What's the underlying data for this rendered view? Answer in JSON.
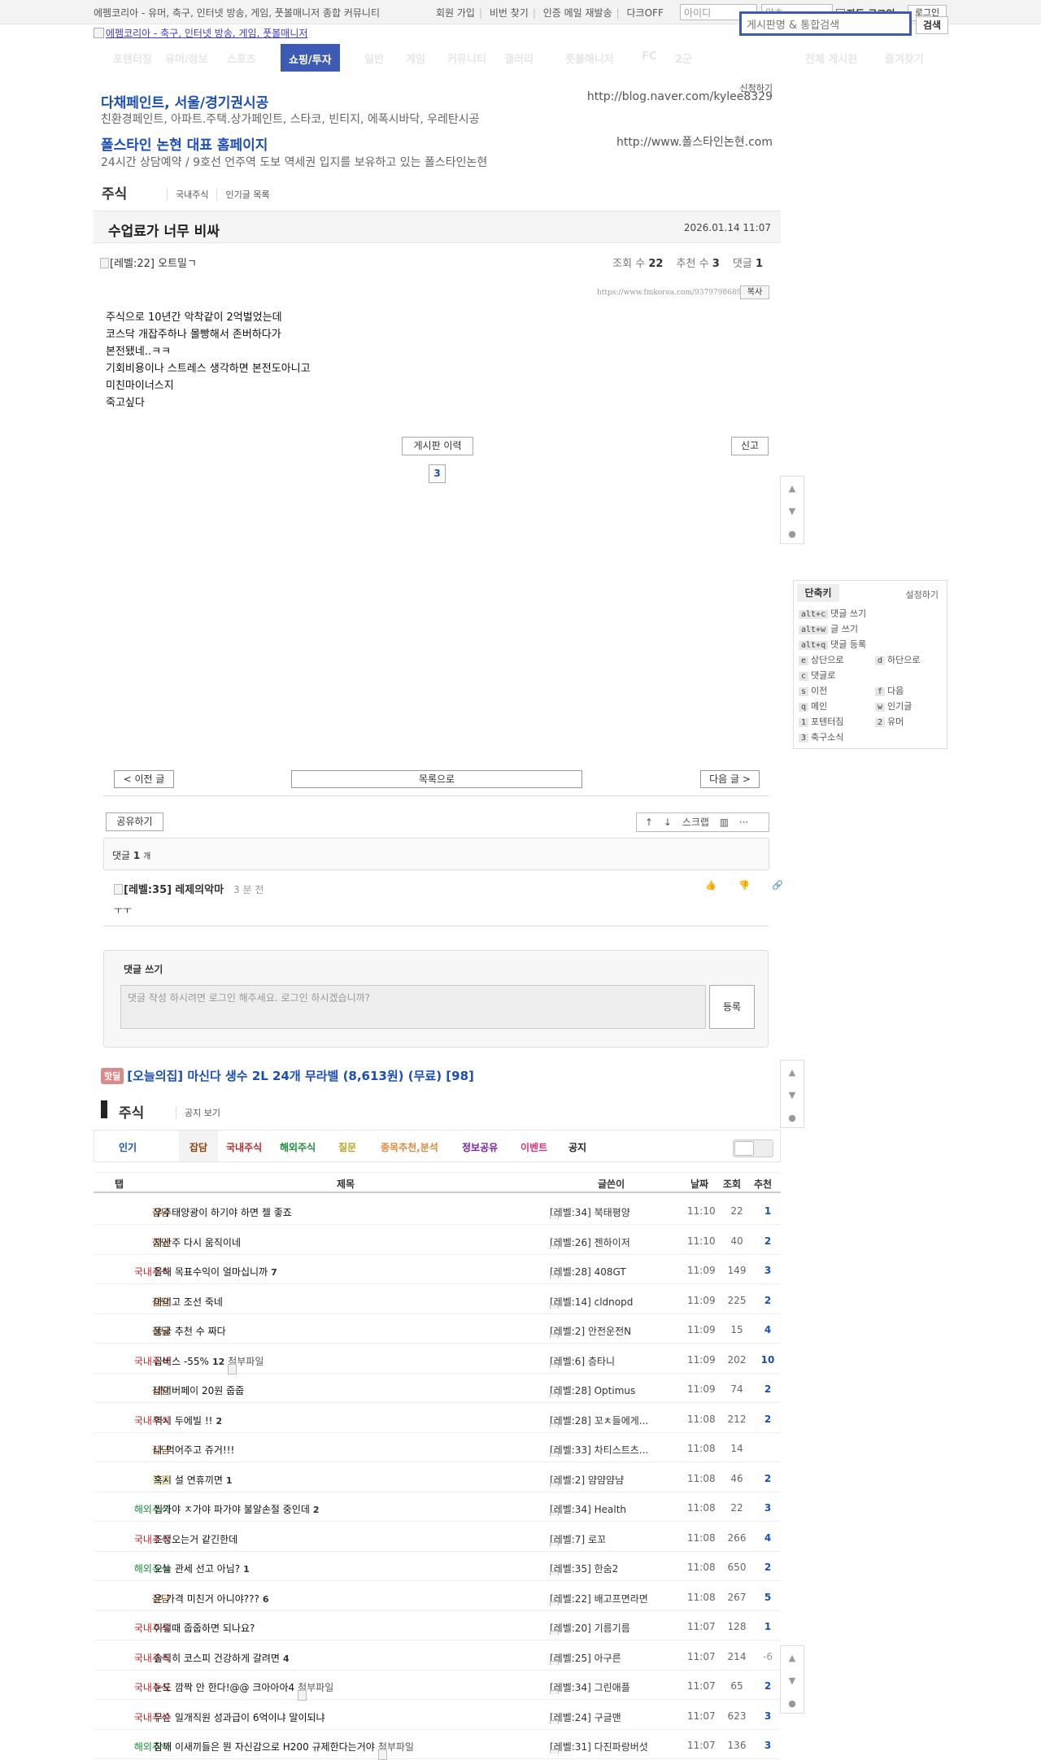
{
  "top": {
    "tagline": "에펨코리아 - 유머, 축구, 인터넷 방송, 게임, 풋볼매니저 종합 커뮤니티",
    "links": [
      "회원 가입",
      "비번 찾기",
      "인증 메일 재발송",
      "다크OFF"
    ],
    "id_placeholder": "아이디",
    "pw_placeholder": "암호",
    "auto_login": "자동 로그인",
    "login": "로그인",
    "search_placeholder": "게시판명 & 통합검색",
    "search_btn": "검색",
    "logo_text": "에펨코리아 - 축구, 인터넷 방송, 게임, 풋볼매니저"
  },
  "gnb": {
    "items": [
      "포텐터짐",
      "유머/정보",
      "스포츠",
      "쇼핑/투자",
      "일반",
      "게임",
      "커뮤니티",
      "갤러리",
      "풋볼매니저",
      "FC",
      "2군",
      "전체 게시판",
      "즐겨찾기"
    ],
    "active_index": 3
  },
  "ads": {
    "apply": "신청하기",
    "items": [
      {
        "title": "다채페인트, 서울/경기권시공",
        "desc": "친환경페인트, 아파트.주택.상가페인트, 스타코, 빈티지, 에폭시바닥, 우레탄시공",
        "url": "http://blog.naver.com/kylee8329"
      },
      {
        "title": "폴스타인 논현 대표 홈페이지",
        "desc": "24시간 상담예약 / 9호선 언주역 도보 역세권 입지를 보유하고 있는 폴스타인논현",
        "url": "http://www.폴스타인논현.com"
      }
    ]
  },
  "board": {
    "name": "주식",
    "sub_links": [
      "국내주식",
      "인기글 목록"
    ]
  },
  "post": {
    "title": "수업료가 너무 비싸",
    "date": "2026.01.14 11:07",
    "author_level": "[레벨:22]",
    "author": "오트밀ㄱ",
    "views_label": "조회 수",
    "views": "22",
    "recs_label": "추천 수",
    "recs": "3",
    "comments_label": "댓글",
    "comments": "1",
    "url": "https://www.fmkorea.com/9379798689",
    "copy": "복사",
    "lines": [
      "주식으로 10년간 악착같이 2억벌었는데",
      "코스닥 개잡주하나 몰빵해서 존버하다가",
      "본전됐네..ㅋㅋ",
      "기회비용이나 스트레스 생각하면 본전도아니고",
      "미친마이너스지",
      "죽고싶다"
    ],
    "history_btn": "게시판 이력",
    "report_btn": "신고",
    "vote_count": "3"
  },
  "floatnav": {
    "up": "▲",
    "down": "▼",
    "comment": "●"
  },
  "shortcut": {
    "title": "단축키",
    "settings": "설정하기",
    "rows": [
      {
        "key": "alt+c",
        "label": "댓글 쓰기"
      },
      {
        "key": "alt+w",
        "label": "글 쓰기"
      },
      {
        "key": "alt+q",
        "label": "댓글 등록"
      }
    ],
    "grid": [
      {
        "key": "e",
        "label": "상단으로"
      },
      {
        "key": "d",
        "label": "하단으로"
      },
      {
        "key": "c",
        "label": "댓글로"
      },
      {
        "key": "",
        "label": ""
      },
      {
        "key": "s",
        "label": "이전"
      },
      {
        "key": "f",
        "label": "다음"
      },
      {
        "key": "q",
        "label": "메인"
      },
      {
        "key": "w",
        "label": "인기글"
      },
      {
        "key": "1",
        "label": "포텐터짐"
      },
      {
        "key": "2",
        "label": "유머"
      },
      {
        "key": "3",
        "label": "축구소식"
      },
      {
        "key": "",
        "label": ""
      }
    ]
  },
  "nav": {
    "prev": "< 이전 글",
    "list": "목록으로",
    "next": "다음 글 >"
  },
  "tools": {
    "share": "공유하기",
    "items": [
      "↑",
      "↓",
      "스크랩",
      "▥",
      "···"
    ]
  },
  "comments": {
    "count_label": "댓글",
    "count": "1",
    "count_unit": "개",
    "item": {
      "level": "[레벨:35]",
      "author": "레제의악마",
      "time": "3 분 전",
      "text": "ㅜㅜ"
    },
    "icons": "👍 👎 🔗",
    "write_title": "댓글 쓰기",
    "write_placeholder": "댓글 작성 하시려면 로그인 해주세요. 로그인 하시겠습니까?",
    "submit": "등록"
  },
  "hotdeal": {
    "tag": "핫딜",
    "text": "[오늘의집] 마신다 생수 2L 24개 무라벨 (8,613원) (무료) [98]"
  },
  "list": {
    "name": "주식",
    "notice": "공지 보기",
    "cats": [
      {
        "label": "인기",
        "color": "#1b4fb5"
      },
      {
        "label": "잡담",
        "color": "#8b4513"
      },
      {
        "label": "국내주식",
        "color": "#c0282b"
      },
      {
        "label": "해외주식",
        "color": "#1a8f3a"
      },
      {
        "label": "질문",
        "color": "#b9a327"
      },
      {
        "label": "종목추천,분석",
        "color": "#e08a3c"
      },
      {
        "label": "정보공유",
        "color": "#7a1fa8"
      },
      {
        "label": "이벤트",
        "color": "#e0307a"
      },
      {
        "label": "공지",
        "color": "#222222"
      }
    ],
    "headers": [
      "탭",
      "제목",
      "글쓴이",
      "날짜",
      "조회",
      "추천"
    ],
    "rows": [
      {
        "tab": "잡담",
        "title": "우주태양광이 하기야 하면 젤 좋죠",
        "cmt": "",
        "att": "",
        "level": "[레벨:34]",
        "author": "북태평양",
        "time": "11:10",
        "views": "22",
        "rec": "1"
      },
      {
        "tab": "잡담",
        "title": "자산주 다시 움직이네",
        "cmt": "",
        "att": "",
        "level": "[레벨:26]",
        "author": "젠하이저",
        "time": "11:10",
        "views": "40",
        "rec": "2"
      },
      {
        "tab": "국내주식",
        "title": "올해 목표수익이 얼마십니까",
        "cmt": "7",
        "att": "",
        "level": "[레벨:28]",
        "author": "408GT",
        "time": "11:09",
        "views": "149",
        "rec": "3"
      },
      {
        "tab": "잡담",
        "title": "아이고 조선 죽네",
        "cmt": "",
        "att": "",
        "level": "[레벨:14]",
        "author": "cldnopd",
        "time": "11:09",
        "views": "225",
        "rec": "2"
      },
      {
        "tab": "잡담",
        "title": "똥글 추천 수 짜다",
        "cmt": "",
        "att": "",
        "level": "[레벨:2]",
        "author": "안전운전N",
        "time": "11:09",
        "views": "15",
        "rec": "4"
      },
      {
        "tab": "국내주식",
        "title": "곱버스 -55%",
        "cmt": "12",
        "att": "첨부파일",
        "level": "[레벨:6]",
        "author": "층타니",
        "time": "11:09",
        "views": "202",
        "rec": "10"
      },
      {
        "tab": "잡담",
        "title": "네이버페이 20원 줍줍",
        "cmt": "",
        "att": "",
        "level": "[레벨:28]",
        "author": "Optimus",
        "time": "11:09",
        "views": "74",
        "rec": "2"
      },
      {
        "tab": "국내주식",
        "title": "역시 두에빌 !!",
        "cmt": "2",
        "att": "",
        "level": "[레벨:28]",
        "author": "꼬ㅊ들에게...",
        "time": "11:08",
        "views": "212",
        "rec": "2"
      },
      {
        "tab": "잡담",
        "title": "나 먹어주고 쥬거!!!",
        "cmt": "",
        "att": "",
        "level": "[레벨:33]",
        "author": "차티스트츠...",
        "time": "11:08",
        "views": "14",
        "rec": ""
      },
      {
        "tab": "질문",
        "title": "혹시 설 연휴끼면",
        "cmt": "1",
        "att": "",
        "level": "[레벨:2]",
        "author": "얌얌얌냠",
        "time": "11:08",
        "views": "46",
        "rec": "2"
      },
      {
        "tab": "해외주식",
        "title": "씹가야 ㅈ가야 파가야 불알손절 중인데",
        "cmt": "2",
        "att": "",
        "level": "[레벨:34]",
        "author": "Health",
        "time": "11:08",
        "views": "22",
        "rec": "3"
      },
      {
        "tab": "국내주식",
        "title": "조정오는거 같긴한데",
        "cmt": "",
        "att": "",
        "level": "[레벨:7]",
        "author": "로꼬",
        "time": "11:08",
        "views": "266",
        "rec": "4"
      },
      {
        "tab": "해외주식",
        "title": "오늘 관세 선고 아님?",
        "cmt": "1",
        "att": "",
        "level": "[레벨:35]",
        "author": "한숨2",
        "time": "11:08",
        "views": "650",
        "rec": "2"
      },
      {
        "tab": "잡담",
        "title": "은 가격 미친거 아니야???",
        "cmt": "6",
        "att": "",
        "level": "[레벨:22]",
        "author": "배고프면라면",
        "time": "11:08",
        "views": "267",
        "rec": "5"
      },
      {
        "tab": "국내주식",
        "title": "이럴때 줍줍하면 되나요?",
        "cmt": "",
        "att": "",
        "level": "[레벨:20]",
        "author": "기름기름",
        "time": "11:07",
        "views": "128",
        "rec": "1"
      },
      {
        "tab": "국내주식",
        "title": "솔직히 코스피 건강하게 갈려면",
        "cmt": "4",
        "att": "",
        "level": "[레벨:25]",
        "author": "아구른",
        "time": "11:07",
        "views": "214",
        "rec": "-6"
      },
      {
        "tab": "국내주식",
        "title": "눈도 깜짝 안 한다!@@ 크아아아4",
        "cmt": "",
        "att": "첨부파일",
        "level": "[레벨:34]",
        "author": "그린애플",
        "time": "11:07",
        "views": "65",
        "rec": "2"
      },
      {
        "tab": "국내주식",
        "title": "무슨 일개직원 성과급이 6억이냐 말이되냐",
        "cmt": "",
        "att": "",
        "level": "[레벨:24]",
        "author": "구글맨",
        "time": "11:07",
        "views": "623",
        "rec": "3"
      },
      {
        "tab": "해외주식",
        "title": "참깨 이새끼들은 뭔 자신감으로 H200 규제한다는거야",
        "cmt": "",
        "att": "첨부파일",
        "level": "[레벨:31]",
        "author": "다진파랑버섯",
        "time": "11:07",
        "views": "136",
        "rec": "3"
      }
    ]
  }
}
